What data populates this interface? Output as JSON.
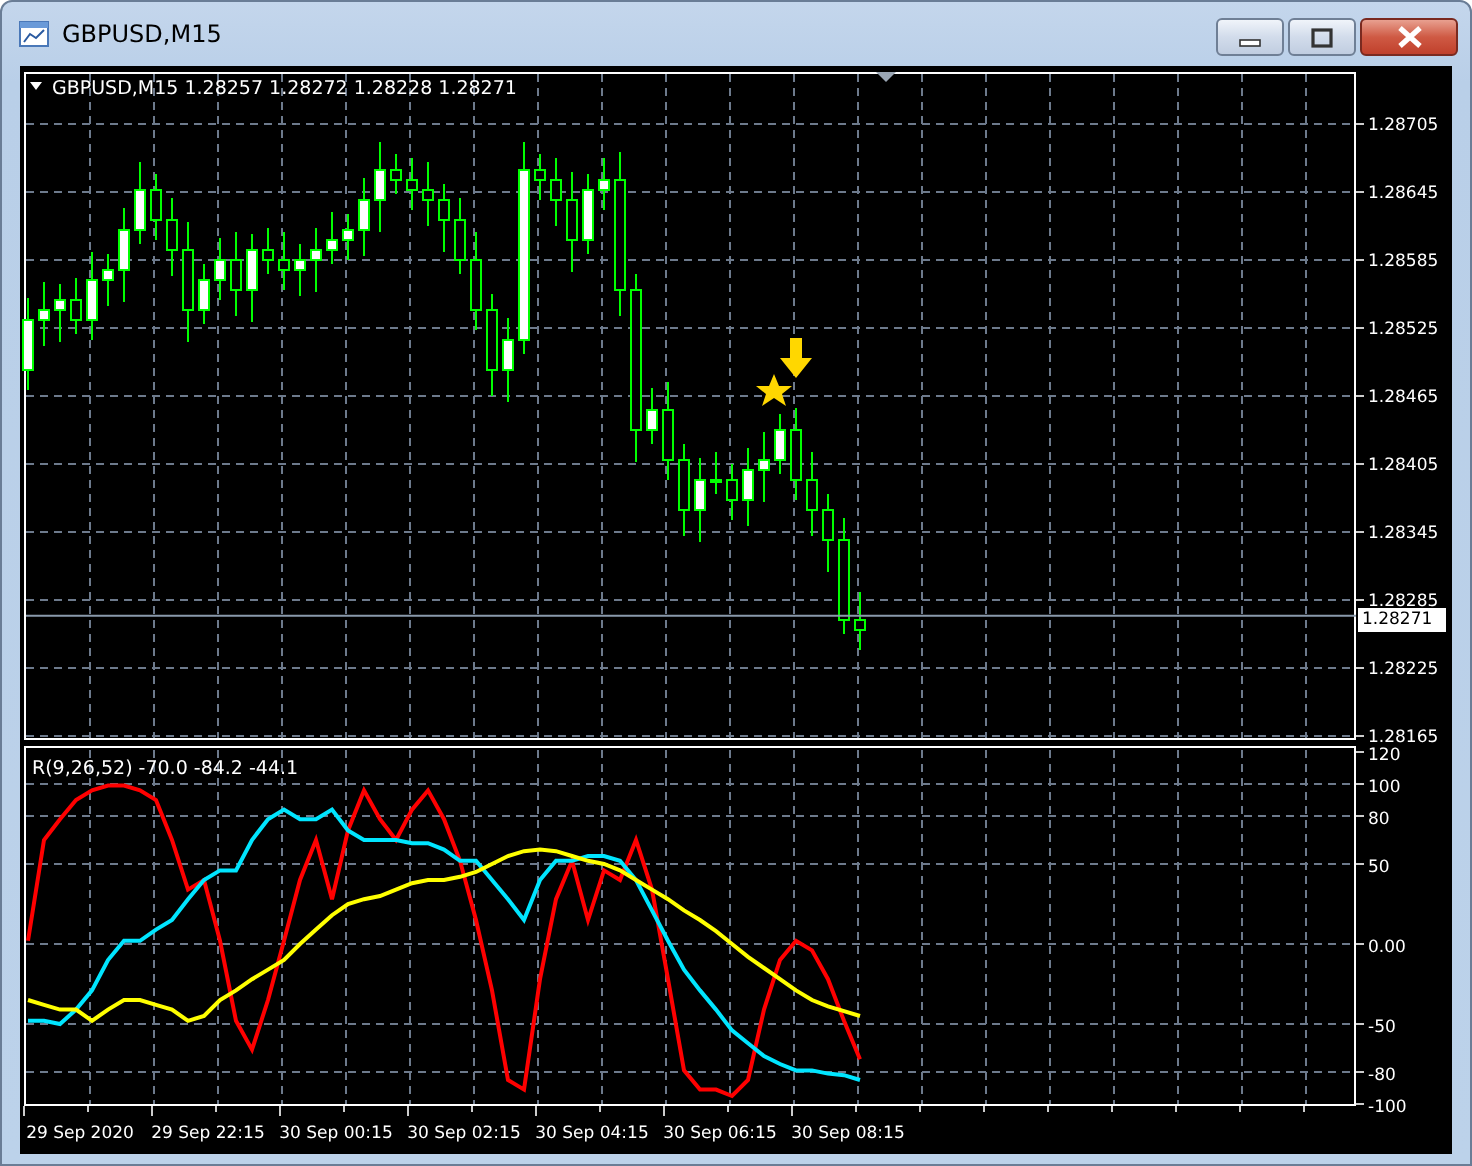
{
  "window": {
    "title": "GBPUSD,M15"
  },
  "price_panel": {
    "symbol": "GBPUSD,M15",
    "ohlc": [
      "1.28257",
      "1.28272",
      "1.28228",
      "1.28271"
    ],
    "price_labels": [
      "1.28705",
      "1.28645",
      "1.28585",
      "1.28525",
      "1.28465",
      "1.28405",
      "1.28345",
      "1.28285",
      "1.28225",
      "1.28165"
    ],
    "current_price": "1.28271"
  },
  "oscillator": {
    "chart_data": {
      "type": "line",
      "title": "R(9,26,52) -70.0 -84.2 -44.1",
      "categories": [
        null,
        null,
        null,
        "29 Sep 2020",
        null,
        null,
        null,
        null,
        null,
        null,
        null,
        "29 Sep 22:15",
        null,
        null,
        null,
        null,
        null,
        null,
        null,
        "30 Sep 00:15",
        null,
        null,
        null,
        null,
        null,
        null,
        null,
        "30 Sep 02:15",
        null,
        null,
        null,
        null,
        null,
        null,
        null,
        "30 Sep 04:15",
        null,
        null,
        null,
        null,
        null,
        null,
        null,
        "30 Sep 06:15",
        null,
        null,
        null,
        null,
        null,
        null,
        null,
        "30 Sep 08:15",
        null
      ],
      "grid": true,
      "yticks": [
        {
          "value": 120,
          "label": "120"
        },
        {
          "value": 100,
          "label": "100"
        },
        {
          "value": 80,
          "label": "80"
        },
        {
          "value": 50,
          "label": "50"
        },
        {
          "value": 0,
          "label": "0.00"
        },
        {
          "value": -50,
          "label": "-50"
        },
        {
          "value": -80,
          "label": "-80"
        },
        {
          "value": -100,
          "label": "-100"
        }
      ],
      "ylim": [
        -100,
        120
      ],
      "series": [
        {
          "color": "#ff0000",
          "values": [
            2,
            65,
            78,
            90,
            96,
            99,
            99,
            96,
            90,
            65,
            34,
            40,
            2,
            -48,
            -66,
            -35,
            2,
            40,
            65,
            28,
            71,
            96,
            78,
            65,
            84,
            96,
            78,
            52,
            15,
            -29,
            -85,
            -91,
            -22,
            28,
            52,
            15,
            46,
            40,
            65,
            34,
            -22,
            -79,
            -91,
            -91,
            -95,
            -85,
            -41,
            -10,
            2,
            -4,
            -22,
            -48,
            -72
          ]
        },
        {
          "color": "#00e5ff",
          "values": [
            -48,
            -48,
            -50,
            -41,
            -29,
            -10,
            2,
            2,
            9,
            15,
            28,
            40,
            46,
            46,
            65,
            78,
            84,
            78,
            78,
            84,
            71,
            65,
            65,
            65,
            63,
            63,
            59,
            52,
            52,
            40,
            28,
            15,
            40,
            52,
            52,
            55,
            55,
            52,
            40,
            21,
            2,
            -16,
            -29,
            -41,
            -54,
            -62,
            -70,
            -75,
            -79,
            -79,
            -81,
            -82,
            -85
          ]
        },
        {
          "color": "#ffff00",
          "values": [
            -35,
            -38,
            -41,
            -41,
            -48,
            -41,
            -35,
            -35,
            -38,
            -41,
            -48,
            -45,
            -35,
            -29,
            -22,
            -16,
            -10,
            0,
            9,
            18,
            25,
            28,
            30,
            34,
            38,
            40,
            40,
            42,
            45,
            50,
            55,
            58,
            59,
            58,
            55,
            52,
            50,
            46,
            40,
            34,
            28,
            21,
            15,
            8,
            0,
            -8,
            -15,
            -22,
            -29,
            -35,
            -39,
            -42,
            -45
          ]
        }
      ]
    }
  }
}
